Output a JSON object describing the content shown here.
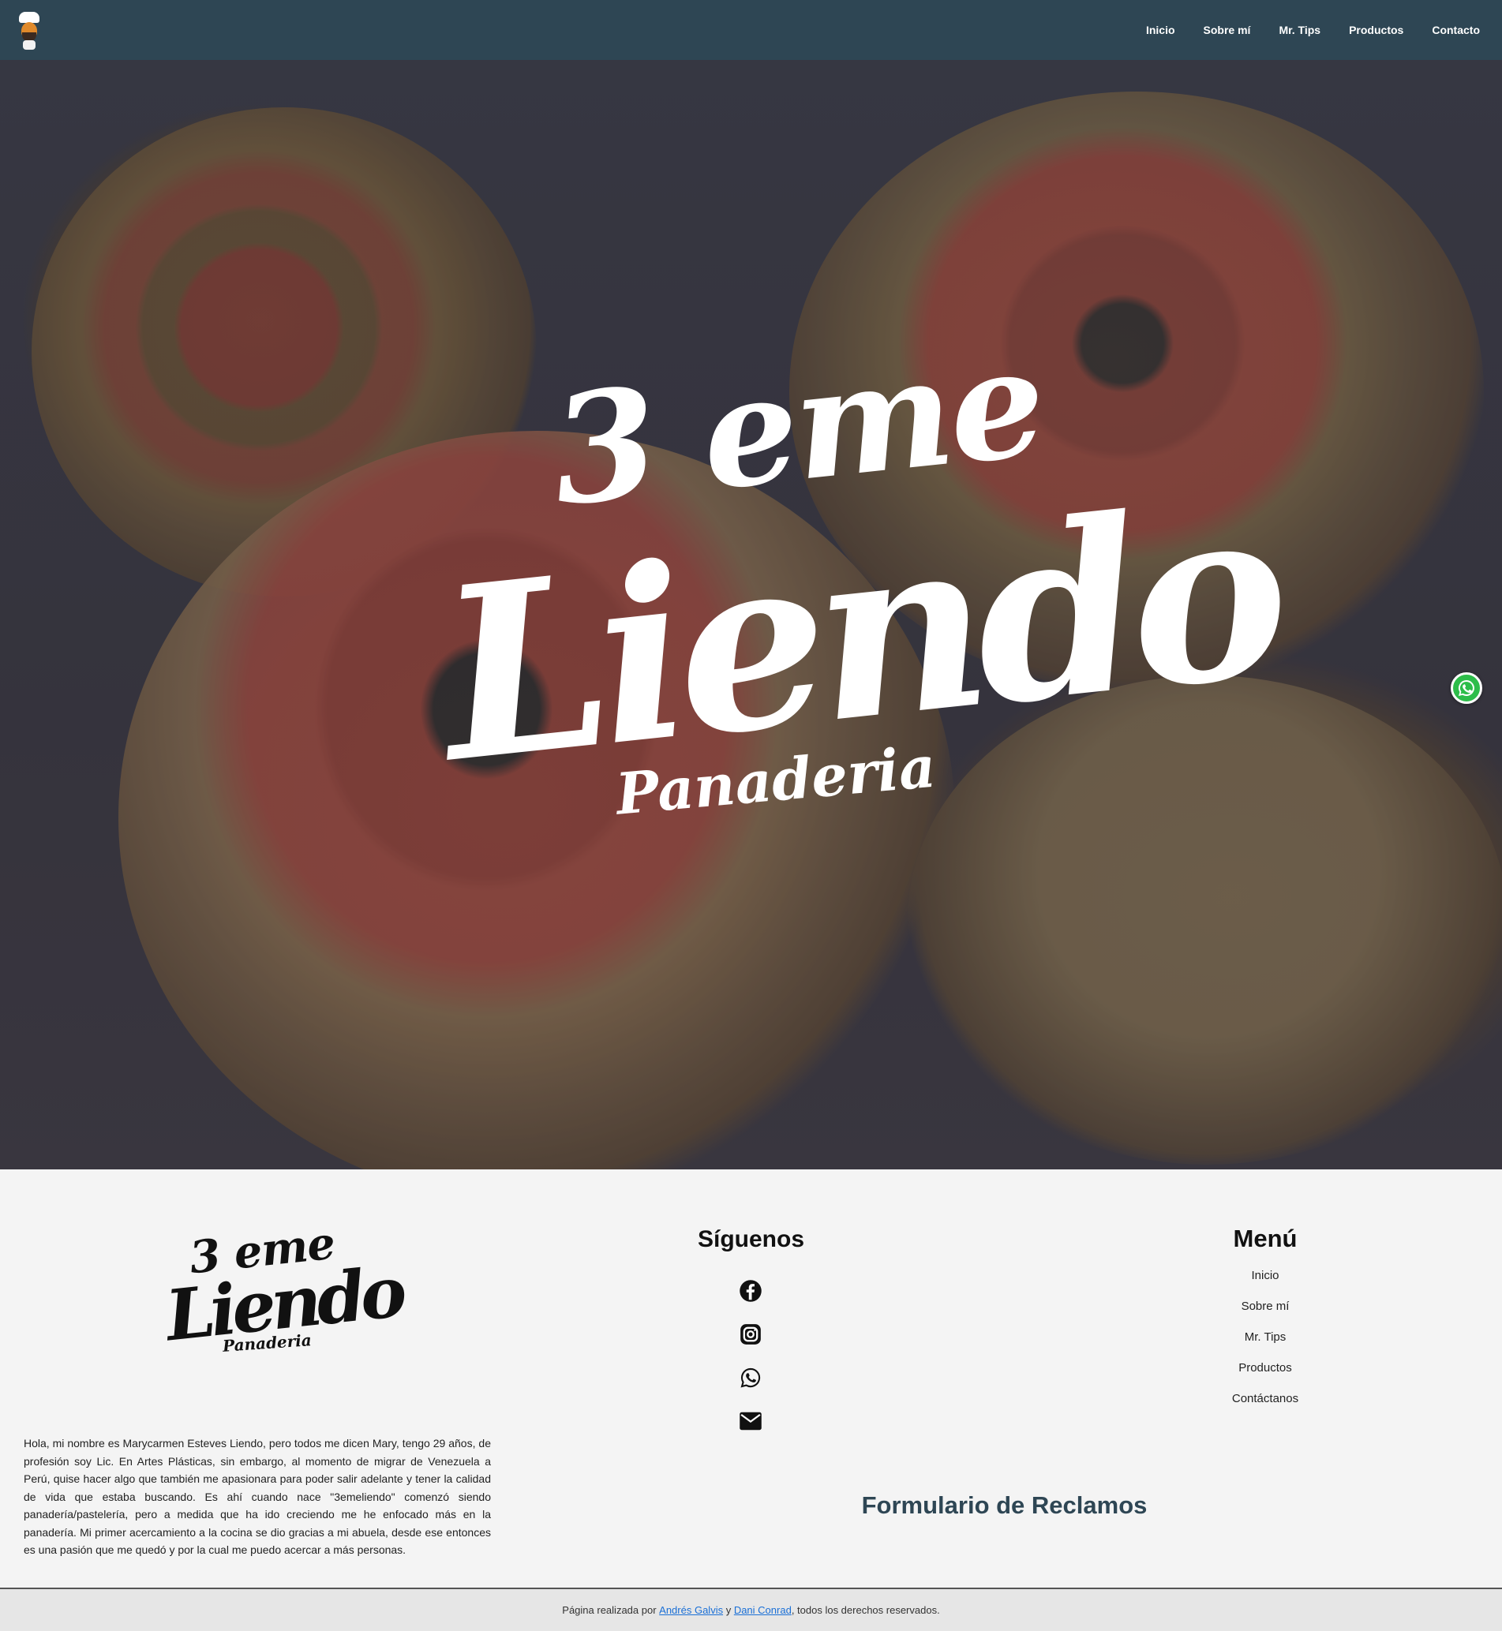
{
  "nav": {
    "items": [
      "Inicio",
      "Sobre mí",
      "Mr. Tips",
      "Productos",
      "Contacto"
    ]
  },
  "hero": {
    "brand_line1": "3 eme",
    "brand_line2": "Liendo",
    "brand_line3": "Panaderia"
  },
  "footer": {
    "logo": {
      "line1": "3 eme",
      "line2": "Liendo",
      "line3": "Panaderia"
    },
    "about": "Hola, mi nombre es Marycarmen Esteves Liendo, pero todos me dicen Mary, tengo 29 años, de profesión soy Lic. En Artes Plásticas, sin embargo, al momento de migrar de Venezuela a Perú, quise hacer algo que también me apasionara para poder salir adelante y tener la calidad de vida que estaba buscando. Es ahí cuando nace \"3emeliendo\" comenzó siendo panadería/pastelería, pero a medida que ha ido creciendo me he enfocado más en la panadería. Mi primer acercamiento a la cocina se dio gracias a mi abuela, desde ese entonces es una pasión que me quedó y por la cual me puedo acercar a más personas.",
    "follow_title": "Síguenos",
    "social_icons": [
      "facebook-icon",
      "instagram-icon",
      "whatsapp-icon",
      "email-icon"
    ],
    "menu_title": "Menú",
    "menu_items": [
      "Inicio",
      "Sobre mí",
      "Mr. Tips",
      "Productos",
      "Contáctanos"
    ],
    "claims_title": "Formulario de Reclamos"
  },
  "copyright": {
    "prefix": "Página realizada por ",
    "author1": "Andrés Galvis",
    "joiner": " y ",
    "author2": "Dani Conrad",
    "suffix": ", todos los derechos reservados."
  },
  "colors": {
    "nav_bg": "#2e4654",
    "whatsapp": "#2dbd4a",
    "claims_title": "#2e4654",
    "link": "#1a6fd6"
  }
}
